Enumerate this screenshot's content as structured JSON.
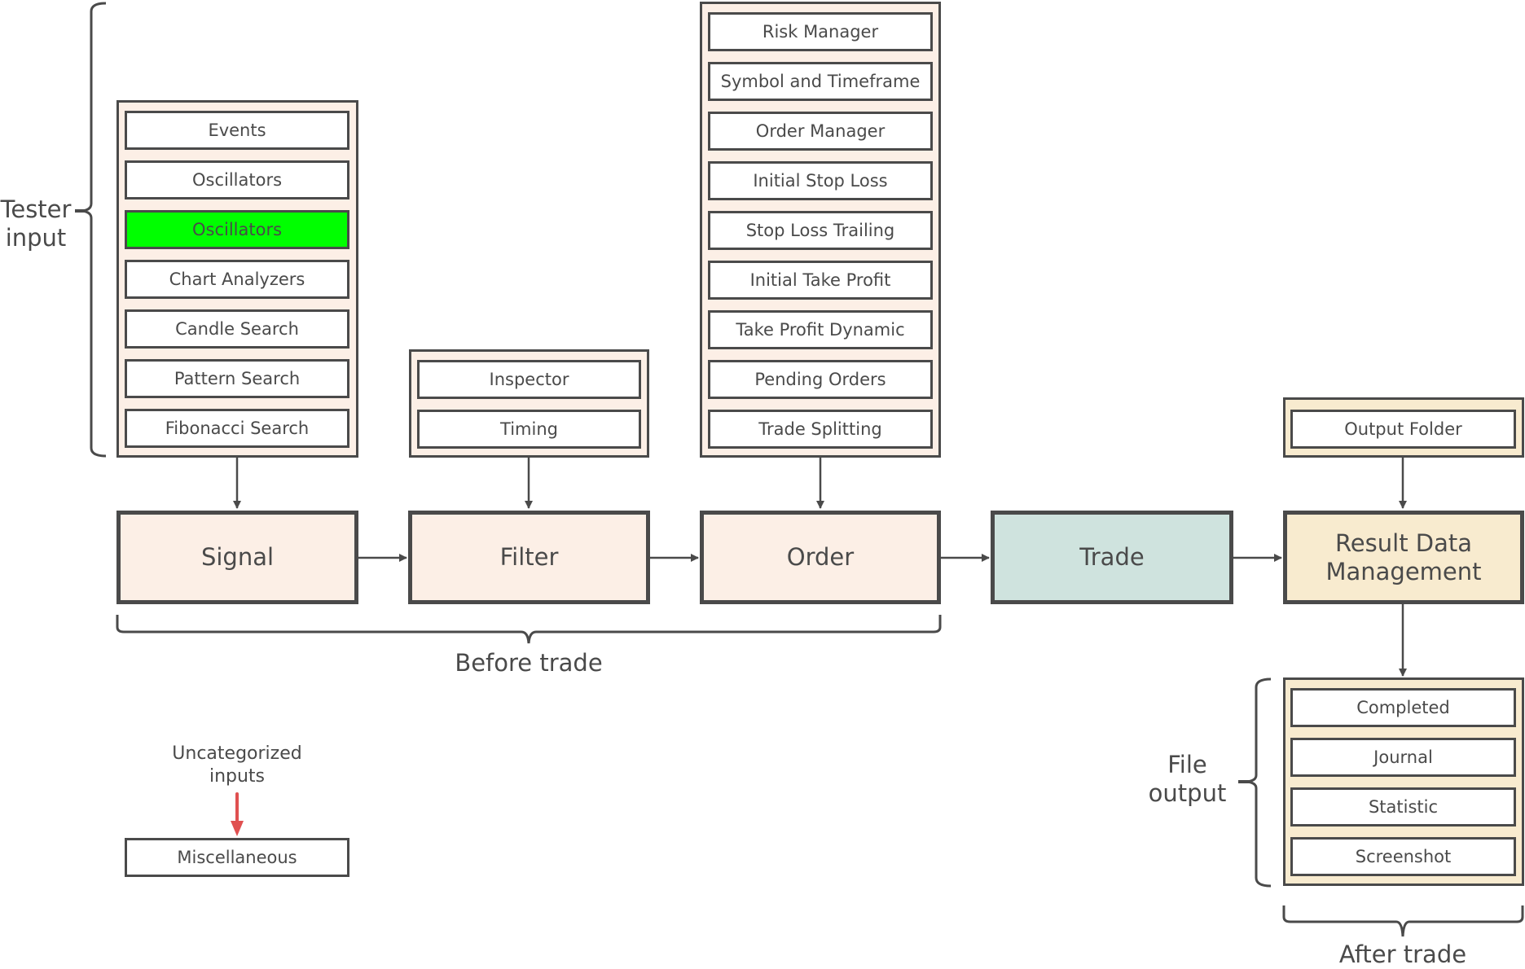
{
  "annotations": {
    "tester_input": "Tester input",
    "before_trade": "Before trade",
    "after_trade": "After trade",
    "file_output": "File output",
    "uncategorized": "Uncategorized inputs"
  },
  "stages": {
    "signal": "Signal",
    "filter": "Filter",
    "order": "Order",
    "trade": "Trade",
    "result": "Result Data Management"
  },
  "signal_inputs": [
    {
      "label": "Events",
      "highlighted": false
    },
    {
      "label": "Oscillators",
      "highlighted": false
    },
    {
      "label": "Oscillators",
      "highlighted": true
    },
    {
      "label": "Chart Analyzers",
      "highlighted": false
    },
    {
      "label": "Candle Search",
      "highlighted": false
    },
    {
      "label": "Pattern Search",
      "highlighted": false
    },
    {
      "label": "Fibonacci Search",
      "highlighted": false
    }
  ],
  "filter_inputs": [
    "Inspector",
    "Timing"
  ],
  "order_inputs": [
    "Risk Manager",
    "Symbol and Timeframe",
    "Order Manager",
    "Initial Stop Loss",
    "Stop Loss Trailing",
    "Initial Take Profit",
    "Take Profit Dynamic",
    "Pending Orders",
    "Trade Splitting"
  ],
  "result_inputs": [
    "Output Folder"
  ],
  "file_outputs": [
    "Completed",
    "Journal",
    "Statistic",
    "Screenshot"
  ],
  "misc": {
    "label": "Miscellaneous"
  },
  "colors": {
    "stroke": "#4a4a4a",
    "peach_fill": "#fcefe6",
    "teal_fill": "#cfe3de",
    "cream_fill": "#f8ebcf",
    "highlight": "#00ff00",
    "red_arrow": "#e05050"
  }
}
